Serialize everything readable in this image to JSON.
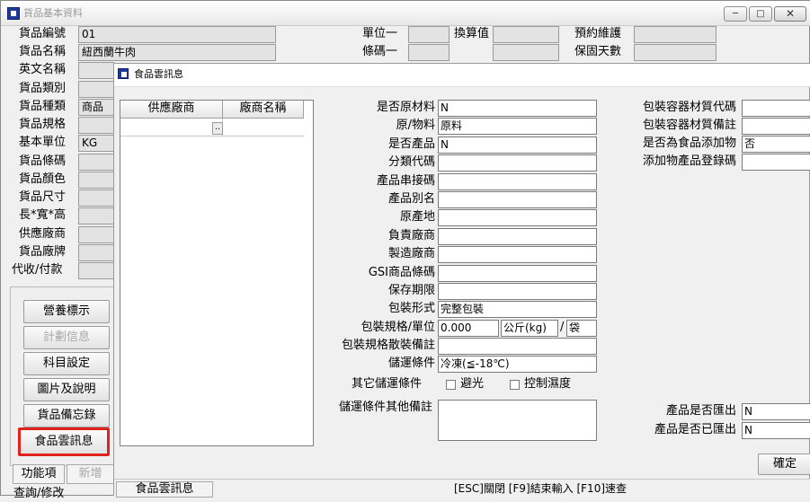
{
  "outer": {
    "title": "貨品基本資料",
    "controls": {
      "minimize": "─",
      "maximize": "□",
      "close": "✕"
    },
    "left_fields": [
      {
        "label": "貨品編號",
        "value": "01"
      },
      {
        "label": "貨品名稱",
        "value": "紐西蘭牛肉"
      },
      {
        "label": "英文名稱",
        "value": ""
      },
      {
        "label": "貨品類別",
        "value": ""
      },
      {
        "label": "貨品種類",
        "value": "商品"
      },
      {
        "label": "貨品規格",
        "value": ""
      },
      {
        "label": "基本單位",
        "value": "KG"
      },
      {
        "label": "貨品條碼",
        "value": ""
      },
      {
        "label": "貨品顏色",
        "value": ""
      },
      {
        "label": "貨品尺寸",
        "value": ""
      },
      {
        "label": "長*寬*高",
        "value": ""
      },
      {
        "label": "供應廠商",
        "value": ""
      },
      {
        "label": "貨品廠牌",
        "value": ""
      },
      {
        "label": "代收/付款",
        "value": ""
      }
    ],
    "mid_fields": [
      {
        "label": "單位一",
        "value": ""
      },
      {
        "label": "條碼一",
        "value": ""
      }
    ],
    "conv_label": "換算值",
    "right_fields": [
      {
        "label": "預約維護",
        "value": ""
      },
      {
        "label": "保固天數",
        "value": ""
      }
    ],
    "side_buttons": [
      {
        "label": "營養標示",
        "enabled": true
      },
      {
        "label": "計劃信息",
        "enabled": false
      },
      {
        "label": "科目設定",
        "enabled": true
      },
      {
        "label": "圖片及說明",
        "enabled": true
      },
      {
        "label": "貨品備忘錄",
        "enabled": true
      },
      {
        "label": "食品雲訊息",
        "enabled": true,
        "highlighted": true
      }
    ],
    "bottom_tabs": [
      "功能項",
      "新增"
    ],
    "partial_bottom": "查詢/修改"
  },
  "dialog": {
    "title": "食品雲訊息",
    "grid": {
      "columns": [
        "供應廠商",
        "廠商名稱"
      ],
      "rows": [
        {
          "supplier": "",
          "ellipsis": "..",
          "name": ""
        }
      ]
    },
    "center_fields": [
      {
        "label": "是否原材料",
        "value": "N"
      },
      {
        "label": "原/物料",
        "value": "原料"
      },
      {
        "label": "是否產品",
        "value": "N"
      },
      {
        "label": "分類代碼",
        "value": ""
      },
      {
        "label": "產品串接碼",
        "value": ""
      },
      {
        "label": "產品別名",
        "value": ""
      },
      {
        "label": "原產地",
        "value": ""
      },
      {
        "label": "負責廠商",
        "value": ""
      },
      {
        "label": "製造廠商",
        "value": ""
      },
      {
        "label": "GSI商品條碼",
        "value": ""
      },
      {
        "label": "保存期限",
        "value": ""
      },
      {
        "label": "包裝形式",
        "value": "完整包裝"
      }
    ],
    "pack_spec": {
      "label": "包裝規格/單位",
      "qty": "0.000",
      "unit": "公斤(kg)",
      "sep": "/",
      "extra": "袋"
    },
    "bulk_note": {
      "label": "包裝規格散裝備註",
      "value": ""
    },
    "storage": {
      "label": "儲運條件",
      "value": "冷凍(≦-18℃)"
    },
    "other_storage": {
      "label": "其它儲運條件",
      "options": [
        {
          "label": "避光",
          "checked": false
        },
        {
          "label": "控制濕度",
          "checked": false
        }
      ]
    },
    "storage_note": {
      "label": "儲運條件其他備註",
      "value": ""
    },
    "right_fields": [
      {
        "label": "包裝容器材質代碼",
        "value": ""
      },
      {
        "label": "包裝容器材質備註",
        "value": ""
      },
      {
        "label": "是否為食品添加物",
        "value": "否"
      },
      {
        "label": "添加物產品登錄碼",
        "value": ""
      }
    ],
    "export_fields": [
      {
        "label": "產品是否匯出",
        "value": "N"
      },
      {
        "label": "產品是否已匯出",
        "value": "N"
      }
    ],
    "confirm_button": "確定",
    "status_tab": "食品雲訊息",
    "status_text": "[ESC]關閉 [F9]結束輸入 [F10]速查"
  }
}
